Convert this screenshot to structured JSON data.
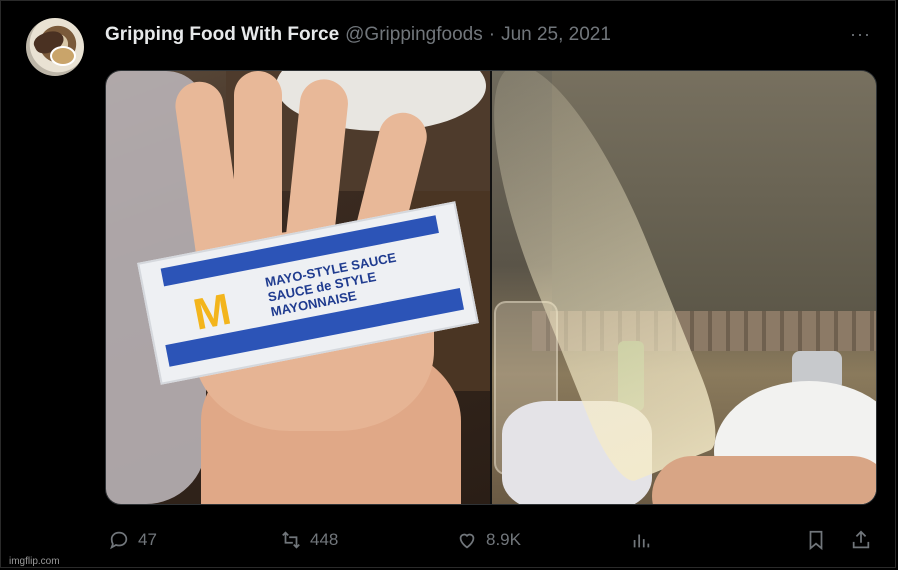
{
  "tweet": {
    "author_name": "Gripping Food With Force",
    "author_handle": "@Grippingfoods",
    "separator": "·",
    "date": "Jun 25, 2021",
    "more_label": "···"
  },
  "media": {
    "packet_text": [
      "MAYO-STYLE SAUCE",
      "SAUCE de STYLE",
      "MAYONNAISE"
    ]
  },
  "actions": {
    "reply_count": "47",
    "retweet_count": "448",
    "like_count": "8.9K"
  },
  "watermark": "imgflip.com",
  "colors": {
    "background": "#000000",
    "text": "#e7e9ea",
    "muted": "#71767b",
    "border": "#2f3336"
  }
}
